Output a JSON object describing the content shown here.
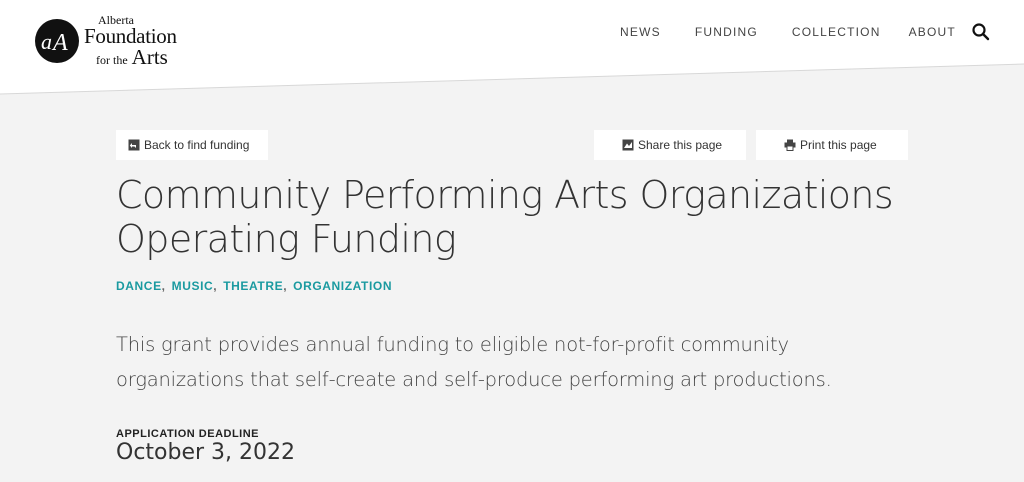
{
  "logo": {
    "line1": "Alberta",
    "line2": "Foundation",
    "line3": "for the",
    "line4": "Arts",
    "mark_icon": "afa-logo-icon"
  },
  "nav": {
    "items": [
      {
        "label": "NEWS",
        "active": false
      },
      {
        "label": "FUNDING",
        "active": true
      },
      {
        "label": "COLLECTION",
        "active": false
      },
      {
        "label": "ABOUT",
        "active": false
      }
    ],
    "search_icon": "search-icon",
    "active_color": "#f5c22f"
  },
  "toolbar": {
    "back_label": "Back to find funding",
    "share_label": "Share this page",
    "print_label": "Print this page"
  },
  "page": {
    "title": "Community Performing Arts Organizations Operating Funding",
    "tags": [
      "DANCE",
      "MUSIC",
      "THEATRE",
      "ORGANIZATION"
    ],
    "tag_color": "#1a9aa0",
    "description": "This grant provides annual funding to eligible not-for-profit community organizations that self-create and self-produce performing art productions.",
    "deadline_label": "APPLICATION DEADLINE",
    "deadline_value": "October 3, 2022"
  }
}
